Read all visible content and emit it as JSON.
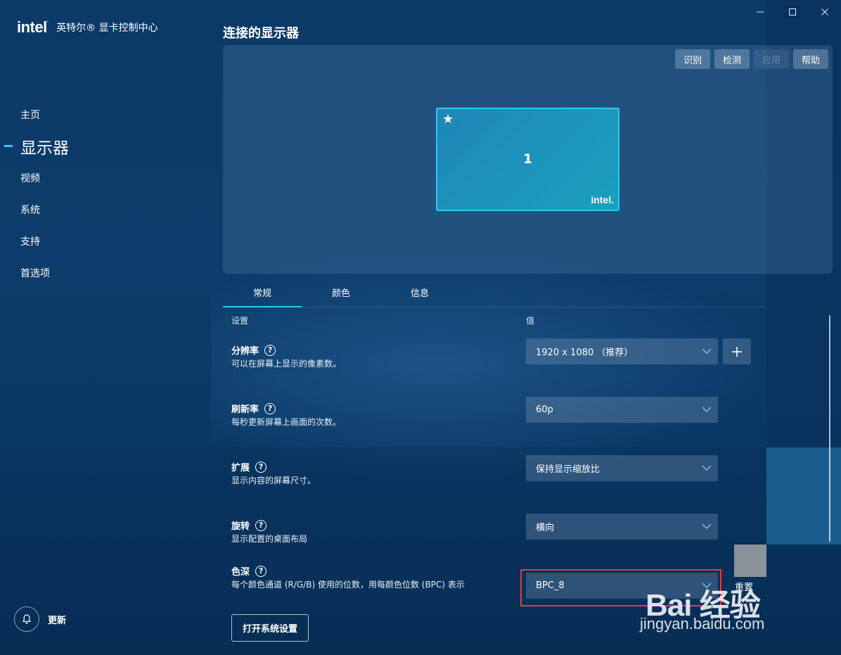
{
  "app": {
    "logo_text": "intel",
    "title": "英特尔® 显卡控制中心"
  },
  "sidebar": {
    "items": [
      {
        "label": "主页"
      },
      {
        "label": "显示器"
      },
      {
        "label": "视频"
      },
      {
        "label": "系统"
      },
      {
        "label": "支持"
      },
      {
        "label": "首选项"
      }
    ],
    "update_label": "更新"
  },
  "main": {
    "title": "连接的显示器",
    "panel_actions": {
      "identify": "识别",
      "detect": "检测",
      "apply": "应用",
      "help": "帮助"
    },
    "monitor": {
      "number": "1",
      "star": "★",
      "logo": "intel."
    },
    "tabs": [
      {
        "label": "常规"
      },
      {
        "label": "颜色"
      },
      {
        "label": "信息"
      }
    ],
    "columns": {
      "setting": "设置",
      "value": "值"
    },
    "rows": [
      {
        "title": "分辨率",
        "desc": "可以在屏幕上显示的像素数。",
        "value": "1920 x 1080 （推荐）"
      },
      {
        "title": "刷新率",
        "desc": "每秒更新屏幕上画面的次数。",
        "value": "60p"
      },
      {
        "title": "扩展",
        "desc": "显示内容的屏幕尺寸。",
        "value": "保持显示缩放比"
      },
      {
        "title": "旋转",
        "desc": "显示配置的桌面布局",
        "value": "横向"
      },
      {
        "title": "色深",
        "desc": "每个颜色通道 (R/G/B) 使用的位数，用每颜色位数 (BPC) 表示",
        "value": "BPC_8",
        "reset": "重置"
      }
    ],
    "help_glyph": "?",
    "open_system_settings": "打开系统设置"
  },
  "watermark": {
    "logo": "Bai 经验",
    "url": "jingyan.baidu.com"
  },
  "colors": {
    "accent": "#3cc0f2",
    "highlight": "#e03c3c",
    "background": "#0b3a68"
  }
}
